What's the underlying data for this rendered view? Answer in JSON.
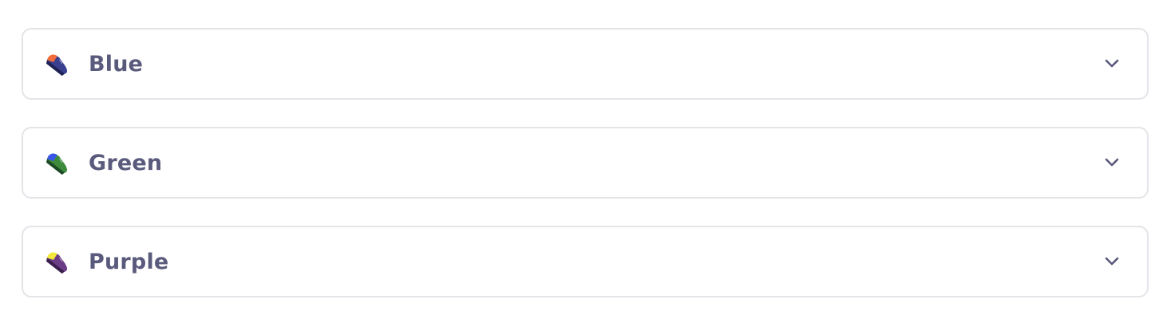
{
  "variants": [
    {
      "label": "Blue",
      "icon": "shoe-icon",
      "colors": {
        "body": "#3a3f8f",
        "accent": "#f26b3a",
        "sole": "#1f2255"
      }
    },
    {
      "label": "Green",
      "icon": "shoe-icon",
      "colors": {
        "body": "#3d8a3c",
        "accent": "#3a56e8",
        "sole": "#1d4a26"
      }
    },
    {
      "label": "Purple",
      "icon": "shoe-icon",
      "colors": {
        "body": "#6a3d86",
        "accent": "#f2e83a",
        "sole": "#3a1e4e"
      }
    }
  ],
  "expand_icon": "chevron-down-icon",
  "text_color": "#5a5a7d",
  "border_color": "#e4e4e9"
}
